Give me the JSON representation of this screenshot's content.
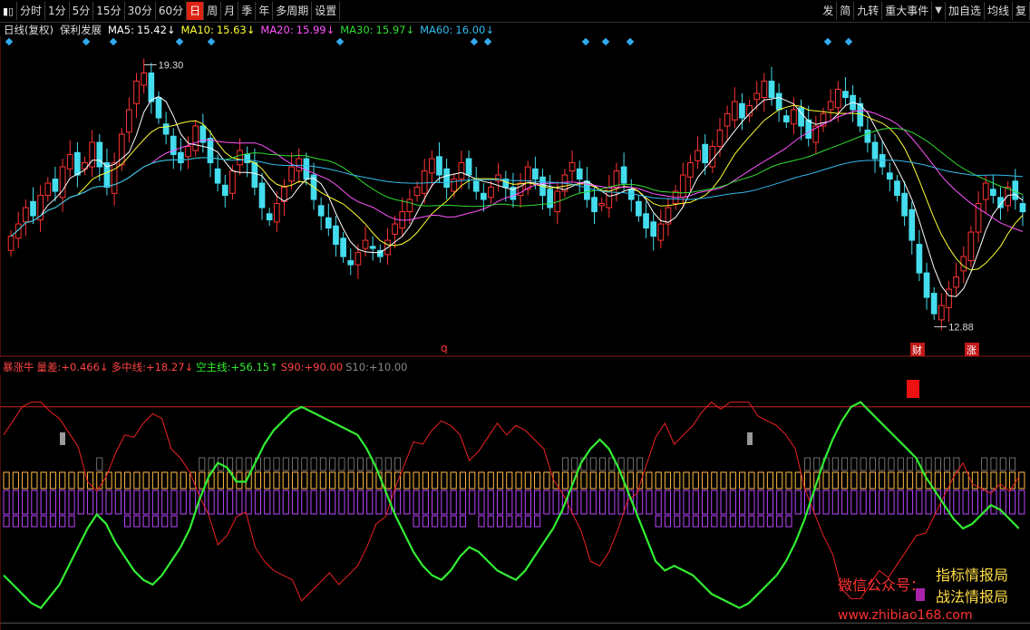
{
  "toolbar": {
    "periods": [
      "分时",
      "1分",
      "5分",
      "15分",
      "30分",
      "60分",
      "日",
      "周",
      "月",
      "季",
      "年",
      "多周期",
      "设置"
    ],
    "active": "日",
    "right_buttons": [
      "发",
      "简",
      "九转",
      "重大事件",
      "加自选",
      "均线",
      "复"
    ]
  },
  "main_info": {
    "title": "日线(复权)",
    "stock": "保利发展",
    "ma5": {
      "label": "MA5:",
      "value": "15.42↓",
      "color": "#ffffff"
    },
    "ma10": {
      "label": "MA10:",
      "value": "15.63↓",
      "color": "#ffff33"
    },
    "ma20": {
      "label": "MA20:",
      "value": "15.99↓",
      "color": "#ff55ff"
    },
    "ma30": {
      "label": "MA30:",
      "value": "15.97↓",
      "color": "#33dd33"
    },
    "ma60": {
      "label": "MA60:",
      "value": "16.00↓",
      "color": "#33bbee"
    }
  },
  "sub_info": {
    "name": "暴涨牛",
    "items": [
      {
        "label": "量差:",
        "value": "+0.466↓",
        "color": "#ff4444"
      },
      {
        "label": "多中线:",
        "value": "+18.27↓",
        "color": "#ff4444"
      },
      {
        "label": "空主线:",
        "value": "+56.15↑",
        "color": "#33ee33"
      },
      {
        "label": "S90:",
        "value": "+90.00",
        "color": "#ff4444"
      },
      {
        "label": "S10:",
        "value": "+10.00",
        "color": "#888888"
      }
    ]
  },
  "annotations": {
    "high": "19.30",
    "low": "12.88",
    "mark_q": "q",
    "mark_cai": "财",
    "mark_zhang": "涨"
  },
  "watermark": {
    "wechat": "微信公众号：",
    "name1": "指标情报局",
    "name2": "战法情报局",
    "url": "www.zhibiao168.com"
  },
  "colors": {
    "up": "#ff3333",
    "down": "#44ddee",
    "ma5": "#ffffff",
    "ma10": "#ffff33",
    "ma20": "#ff55ff",
    "ma30": "#33dd33",
    "ma60": "#33bbee",
    "green_line": "#33ee33",
    "red_line": "#ee2222",
    "orange_bar": "#ffbb44",
    "purple_bar": "#bb44ff",
    "gray_bar": "#888888"
  },
  "chart_data": {
    "type": "line",
    "title": "保利发展 日线(复权)",
    "price_range": [
      12.88,
      19.3
    ],
    "close": [
      15.1,
      15.4,
      15.8,
      15.6,
      16.1,
      16.4,
      16.2,
      16.8,
      17.1,
      16.6,
      16.9,
      17.4,
      16.8,
      16.3,
      16.9,
      17.6,
      18.2,
      18.9,
      19.1,
      18.4,
      18.0,
      17.6,
      17.1,
      16.9,
      17.3,
      17.8,
      17.4,
      16.9,
      16.4,
      16.1,
      16.7,
      17.2,
      16.9,
      16.3,
      15.8,
      15.5,
      15.9,
      16.3,
      16.8,
      17.0,
      16.5,
      16.0,
      15.6,
      15.3,
      14.9,
      14.6,
      14.4,
      14.7,
      15.0,
      14.8,
      14.6,
      15.0,
      15.4,
      15.7,
      16.0,
      16.3,
      16.7,
      17.0,
      16.6,
      16.3,
      16.5,
      16.9,
      16.6,
      16.2,
      16.0,
      16.3,
      16.6,
      16.3,
      16.0,
      16.4,
      16.8,
      16.5,
      16.1,
      15.8,
      16.2,
      16.6,
      16.9,
      16.5,
      16.0,
      15.7,
      15.9,
      16.3,
      16.7,
      16.4,
      16.0,
      15.6,
      15.3,
      15.1,
      15.4,
      15.8,
      16.2,
      16.6,
      16.9,
      17.2,
      16.9,
      17.3,
      17.7,
      18.1,
      18.4,
      18.0,
      18.3,
      18.6,
      18.9,
      18.5,
      18.2,
      17.9,
      18.2,
      17.8,
      17.5,
      17.8,
      18.1,
      18.4,
      18.7,
      18.5,
      18.2,
      17.8,
      17.4,
      17.0,
      16.8,
      16.5,
      16.1,
      15.6,
      15.0,
      14.2,
      13.6,
      13.2,
      13.4,
      13.8,
      14.1,
      14.6,
      15.2,
      15.9,
      16.4,
      16.1,
      15.8,
      16.3,
      16.0,
      15.7
    ],
    "ma5": [
      15.42
    ],
    "ma10": [
      15.63
    ],
    "ma20": [
      15.99
    ],
    "ma30": [
      15.97
    ],
    "ma60": [
      16.0
    ],
    "indicator": {
      "s90": 90.0,
      "s10": 10.0,
      "green_line": [
        18,
        14,
        10,
        6,
        4,
        9,
        14,
        22,
        30,
        38,
        44,
        40,
        32,
        26,
        20,
        16,
        14,
        18,
        24,
        30,
        38,
        50,
        60,
        66,
        64,
        58,
        58,
        66,
        74,
        80,
        84,
        88,
        90,
        88,
        86,
        84,
        82,
        80,
        78,
        72,
        64,
        54,
        44,
        36,
        28,
        22,
        18,
        16,
        20,
        26,
        30,
        28,
        24,
        20,
        18,
        16,
        20,
        26,
        32,
        38,
        46,
        56,
        66,
        72,
        76,
        72,
        64,
        54,
        44,
        34,
        24,
        20,
        22,
        20,
        18,
        14,
        10,
        8,
        6,
        4,
        6,
        10,
        14,
        18,
        24,
        32,
        42,
        54,
        66,
        76,
        84,
        90,
        92,
        88,
        84,
        80,
        76,
        72,
        68,
        60,
        54,
        48,
        42,
        38,
        40,
        44,
        48,
        46,
        42,
        38
      ]
    }
  }
}
